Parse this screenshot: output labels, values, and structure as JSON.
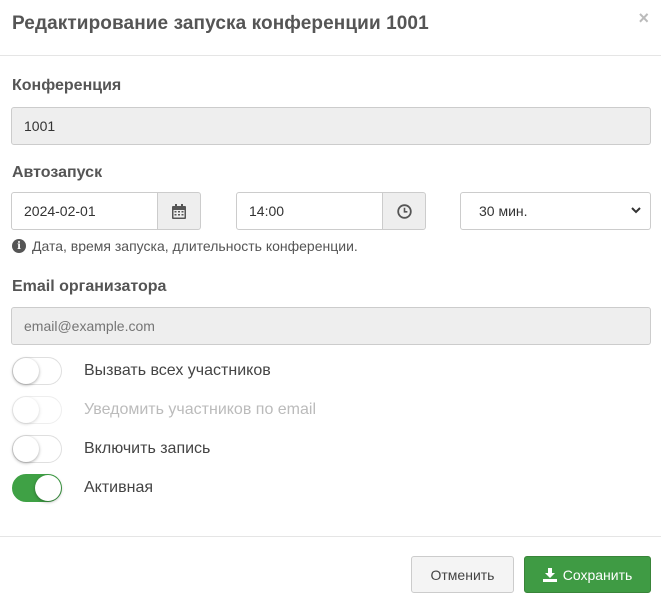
{
  "modal": {
    "title": "Редактирование запуска конференции 1001",
    "close_symbol": "×"
  },
  "conference": {
    "label": "Конференция",
    "value": "1001"
  },
  "autostart": {
    "label": "Автозапуск",
    "date": "2024-02-01",
    "time": "14:00",
    "duration_selected": "30 мин.",
    "help_text": "Дата, время запуска, длительность конференции.",
    "icons": {
      "calendar": "calendar-icon",
      "clock": "clock-icon",
      "info": "info-icon"
    }
  },
  "email": {
    "label": "Email организатора",
    "placeholder": "email@example.com"
  },
  "toggles": [
    {
      "label": "Вызвать всех участников",
      "on": false,
      "disabled": false
    },
    {
      "label": "Уведомить участников по email",
      "on": false,
      "disabled": true
    },
    {
      "label": "Включить запись",
      "on": false,
      "disabled": false
    },
    {
      "label": "Активная",
      "on": true,
      "disabled": false
    }
  ],
  "footer": {
    "cancel_label": "Отменить",
    "save_label": "Сохранить",
    "save_icon": "download-icon"
  },
  "colors": {
    "success": "#3f9b44",
    "toggle_on": "#3fa145",
    "readonly_bg": "#eeeeee"
  }
}
